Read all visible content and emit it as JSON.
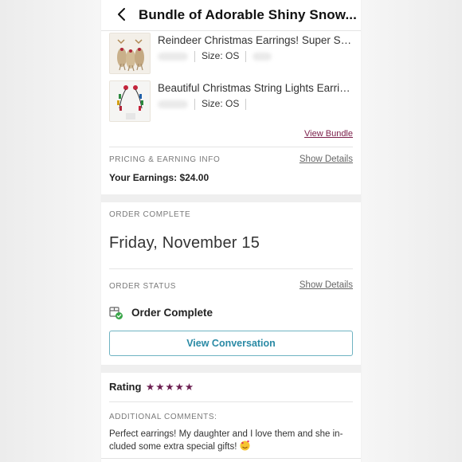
{
  "header": {
    "title": "Bundle of Adorable Shiny Snow..."
  },
  "bundle_items": [
    {
      "title": "Reindeer Christmas Earrings! Super Sp...",
      "size": "Size: OS"
    },
    {
      "title": "Beautiful Christmas String Lights Earrin...",
      "size": "Size: OS"
    }
  ],
  "view_bundle": "View Bundle",
  "pricing": {
    "label": "PRICING & EARNING INFO",
    "show_details": "Show Details",
    "earnings": "Your Earnings: $24.00"
  },
  "order": {
    "complete_label": "ORDER COMPLETE",
    "date": "Friday, November 15",
    "status_label": "ORDER STATUS",
    "show_details": "Show Details",
    "status": "Order Complete",
    "conversation_button": "View Conversation"
  },
  "rating": {
    "label": "Rating",
    "stars": "★★★★★",
    "stars_value": 5,
    "comments_label": "ADDITIONAL COMMENTS:",
    "comment": "Perfect earrings! My daughter and I love them and she in-cluded some extra special gifts!"
  },
  "colors": {
    "accent": "#7b1e4a",
    "button": "#2a8aa5",
    "star": "#6c1f51",
    "status_green": "#3aa64a"
  }
}
